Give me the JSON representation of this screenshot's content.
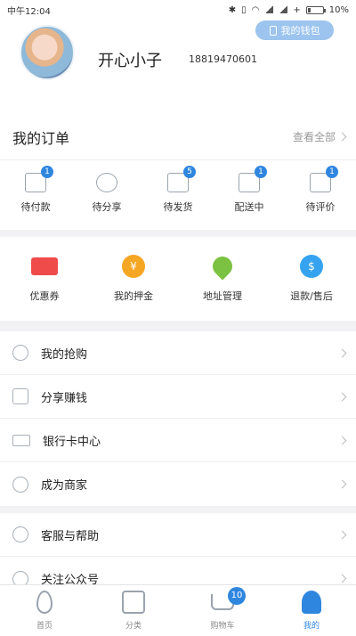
{
  "status_bar": {
    "carrier_time": "中午12:04",
    "battery": "10%"
  },
  "profile": {
    "name": "开心小子",
    "phone": "18819470601",
    "wallet_label": "我的钱包"
  },
  "orders": {
    "title": "我的订单",
    "view_all": "查看全部",
    "items": [
      {
        "label": "待付款",
        "badge": "1",
        "icon": "wallet-icon"
      },
      {
        "label": "待分享",
        "badge": "",
        "icon": "people-icon"
      },
      {
        "label": "待发货",
        "badge": "5",
        "icon": "box-icon"
      },
      {
        "label": "配送中",
        "badge": "1",
        "icon": "truck-icon"
      },
      {
        "label": "待评价",
        "badge": "1",
        "icon": "comment-icon"
      }
    ]
  },
  "quick_links": [
    {
      "label": "优惠券",
      "icon": "coupon-icon",
      "color": "#ef4b4b"
    },
    {
      "label": "我的押金",
      "icon": "deposit-icon",
      "color": "#f5a623"
    },
    {
      "label": "地址管理",
      "icon": "location-pin-icon",
      "color": "#7cc242"
    },
    {
      "label": "退款/售后",
      "icon": "refund-icon",
      "color": "#35a3ef"
    }
  ],
  "menu_group1": [
    {
      "label": "我的抢购",
      "icon": "clock-icon"
    },
    {
      "label": "分享赚钱",
      "icon": "share-icon"
    },
    {
      "label": "银行卡中心",
      "icon": "bank-card-icon"
    },
    {
      "label": "成为商家",
      "icon": "merchant-icon"
    }
  ],
  "menu_group2": [
    {
      "label": "客服与帮助",
      "icon": "help-icon"
    },
    {
      "label": "关注公众号",
      "icon": "heart-icon"
    }
  ],
  "tabbar": [
    {
      "label": "首页",
      "icon": "home-icon"
    },
    {
      "label": "分类",
      "icon": "category-icon"
    },
    {
      "label": "购物车",
      "icon": "cart-icon",
      "badge": "10"
    },
    {
      "label": "我的",
      "icon": "profile-icon",
      "active": true
    }
  ],
  "colors": {
    "accent": "#2f86df",
    "wallet_button": "#9cc4ee"
  }
}
